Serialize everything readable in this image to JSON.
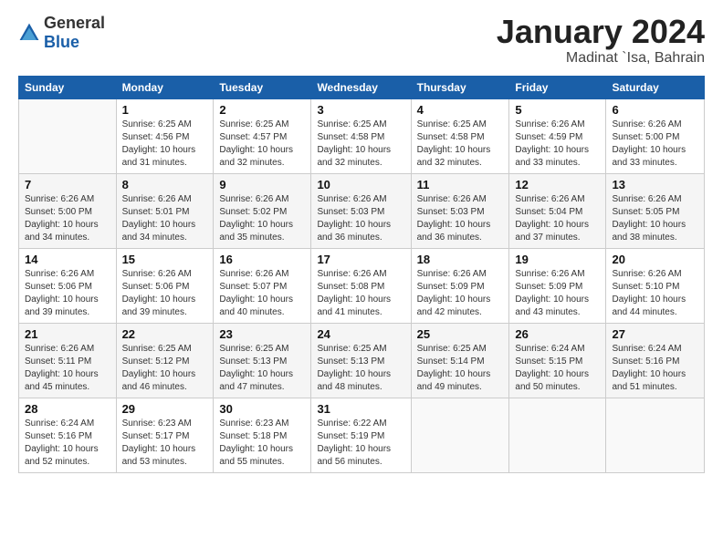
{
  "logo": {
    "general": "General",
    "blue": "Blue"
  },
  "header": {
    "month": "January 2024",
    "location": "Madinat `Isa, Bahrain"
  },
  "weekdays": [
    "Sunday",
    "Monday",
    "Tuesday",
    "Wednesday",
    "Thursday",
    "Friday",
    "Saturday"
  ],
  "weeks": [
    [
      {
        "day": "",
        "info": ""
      },
      {
        "day": "1",
        "info": "Sunrise: 6:25 AM\nSunset: 4:56 PM\nDaylight: 10 hours\nand 31 minutes."
      },
      {
        "day": "2",
        "info": "Sunrise: 6:25 AM\nSunset: 4:57 PM\nDaylight: 10 hours\nand 32 minutes."
      },
      {
        "day": "3",
        "info": "Sunrise: 6:25 AM\nSunset: 4:58 PM\nDaylight: 10 hours\nand 32 minutes."
      },
      {
        "day": "4",
        "info": "Sunrise: 6:25 AM\nSunset: 4:58 PM\nDaylight: 10 hours\nand 32 minutes."
      },
      {
        "day": "5",
        "info": "Sunrise: 6:26 AM\nSunset: 4:59 PM\nDaylight: 10 hours\nand 33 minutes."
      },
      {
        "day": "6",
        "info": "Sunrise: 6:26 AM\nSunset: 5:00 PM\nDaylight: 10 hours\nand 33 minutes."
      }
    ],
    [
      {
        "day": "7",
        "info": "Sunrise: 6:26 AM\nSunset: 5:00 PM\nDaylight: 10 hours\nand 34 minutes."
      },
      {
        "day": "8",
        "info": "Sunrise: 6:26 AM\nSunset: 5:01 PM\nDaylight: 10 hours\nand 34 minutes."
      },
      {
        "day": "9",
        "info": "Sunrise: 6:26 AM\nSunset: 5:02 PM\nDaylight: 10 hours\nand 35 minutes."
      },
      {
        "day": "10",
        "info": "Sunrise: 6:26 AM\nSunset: 5:03 PM\nDaylight: 10 hours\nand 36 minutes."
      },
      {
        "day": "11",
        "info": "Sunrise: 6:26 AM\nSunset: 5:03 PM\nDaylight: 10 hours\nand 36 minutes."
      },
      {
        "day": "12",
        "info": "Sunrise: 6:26 AM\nSunset: 5:04 PM\nDaylight: 10 hours\nand 37 minutes."
      },
      {
        "day": "13",
        "info": "Sunrise: 6:26 AM\nSunset: 5:05 PM\nDaylight: 10 hours\nand 38 minutes."
      }
    ],
    [
      {
        "day": "14",
        "info": "Sunrise: 6:26 AM\nSunset: 5:06 PM\nDaylight: 10 hours\nand 39 minutes."
      },
      {
        "day": "15",
        "info": "Sunrise: 6:26 AM\nSunset: 5:06 PM\nDaylight: 10 hours\nand 39 minutes."
      },
      {
        "day": "16",
        "info": "Sunrise: 6:26 AM\nSunset: 5:07 PM\nDaylight: 10 hours\nand 40 minutes."
      },
      {
        "day": "17",
        "info": "Sunrise: 6:26 AM\nSunset: 5:08 PM\nDaylight: 10 hours\nand 41 minutes."
      },
      {
        "day": "18",
        "info": "Sunrise: 6:26 AM\nSunset: 5:09 PM\nDaylight: 10 hours\nand 42 minutes."
      },
      {
        "day": "19",
        "info": "Sunrise: 6:26 AM\nSunset: 5:09 PM\nDaylight: 10 hours\nand 43 minutes."
      },
      {
        "day": "20",
        "info": "Sunrise: 6:26 AM\nSunset: 5:10 PM\nDaylight: 10 hours\nand 44 minutes."
      }
    ],
    [
      {
        "day": "21",
        "info": "Sunrise: 6:26 AM\nSunset: 5:11 PM\nDaylight: 10 hours\nand 45 minutes."
      },
      {
        "day": "22",
        "info": "Sunrise: 6:25 AM\nSunset: 5:12 PM\nDaylight: 10 hours\nand 46 minutes."
      },
      {
        "day": "23",
        "info": "Sunrise: 6:25 AM\nSunset: 5:13 PM\nDaylight: 10 hours\nand 47 minutes."
      },
      {
        "day": "24",
        "info": "Sunrise: 6:25 AM\nSunset: 5:13 PM\nDaylight: 10 hours\nand 48 minutes."
      },
      {
        "day": "25",
        "info": "Sunrise: 6:25 AM\nSunset: 5:14 PM\nDaylight: 10 hours\nand 49 minutes."
      },
      {
        "day": "26",
        "info": "Sunrise: 6:24 AM\nSunset: 5:15 PM\nDaylight: 10 hours\nand 50 minutes."
      },
      {
        "day": "27",
        "info": "Sunrise: 6:24 AM\nSunset: 5:16 PM\nDaylight: 10 hours\nand 51 minutes."
      }
    ],
    [
      {
        "day": "28",
        "info": "Sunrise: 6:24 AM\nSunset: 5:16 PM\nDaylight: 10 hours\nand 52 minutes."
      },
      {
        "day": "29",
        "info": "Sunrise: 6:23 AM\nSunset: 5:17 PM\nDaylight: 10 hours\nand 53 minutes."
      },
      {
        "day": "30",
        "info": "Sunrise: 6:23 AM\nSunset: 5:18 PM\nDaylight: 10 hours\nand 55 minutes."
      },
      {
        "day": "31",
        "info": "Sunrise: 6:22 AM\nSunset: 5:19 PM\nDaylight: 10 hours\nand 56 minutes."
      },
      {
        "day": "",
        "info": ""
      },
      {
        "day": "",
        "info": ""
      },
      {
        "day": "",
        "info": ""
      }
    ]
  ]
}
